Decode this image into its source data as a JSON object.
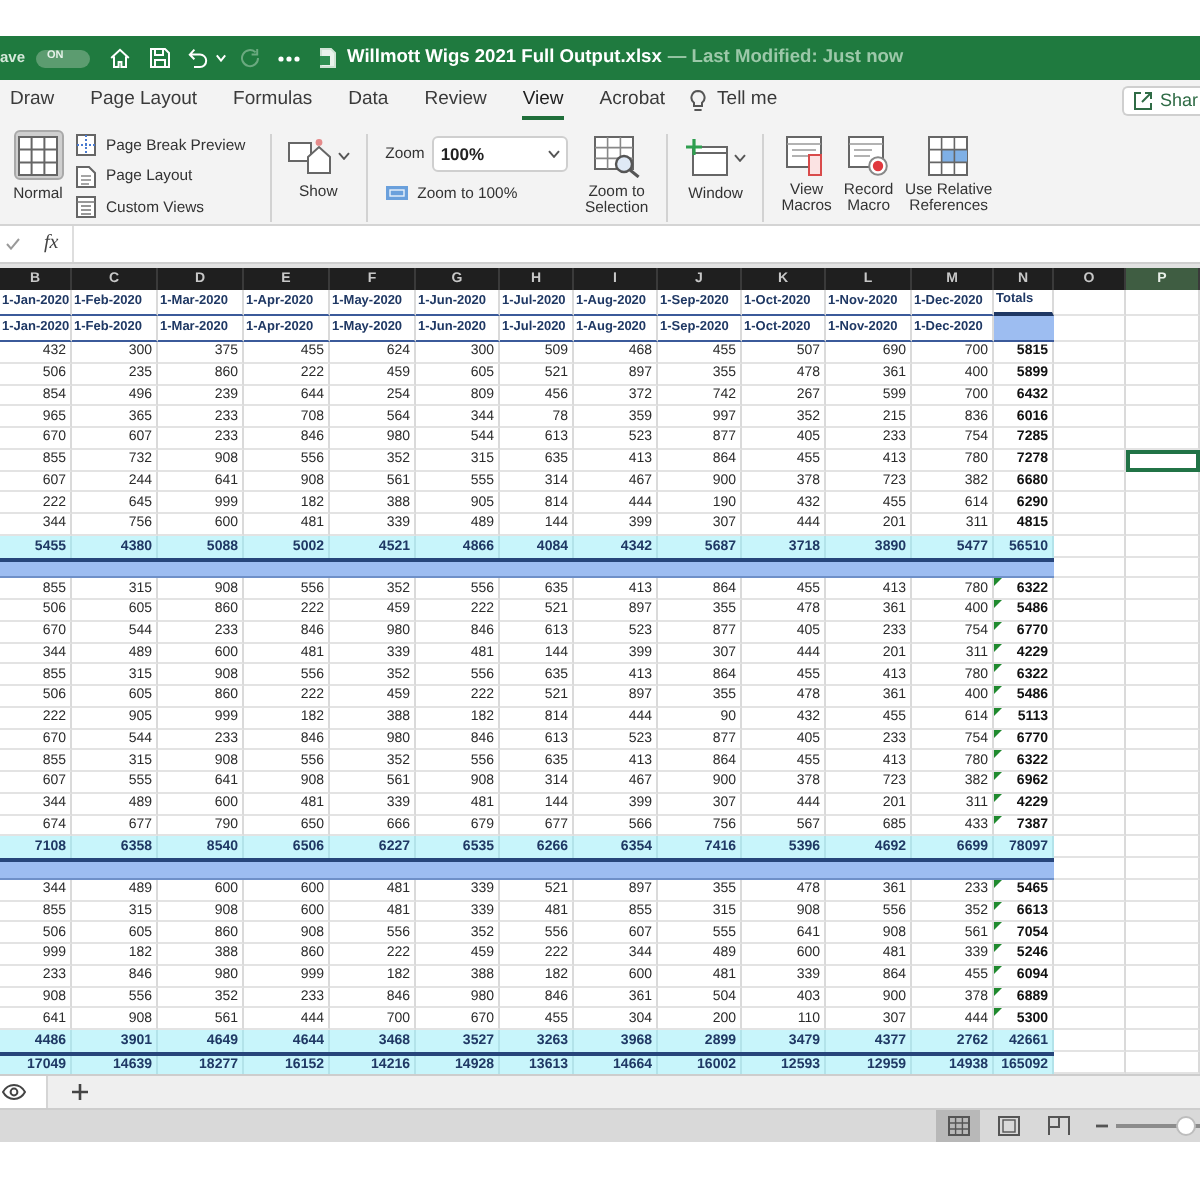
{
  "title_bar": {
    "autosave_label": "ave",
    "autosave_toggle": {
      "label": "ON",
      "on": true
    },
    "quick_access": [
      {
        "kind": "home",
        "disabled": false
      },
      {
        "kind": "save",
        "disabled": false
      },
      {
        "kind": "undo",
        "disabled": false
      },
      {
        "kind": "dropdown",
        "disabled": false
      },
      {
        "kind": "redo",
        "disabled": true
      },
      {
        "kind": "more",
        "disabled": false
      }
    ],
    "file_name": "Willmott Wigs 2021 Full Output.xlsx",
    "status": "— Last Modified: Just now"
  },
  "ribbon_tabs": [
    {
      "label": "Draw",
      "selected": false
    },
    {
      "label": "Page Layout",
      "selected": false
    },
    {
      "label": "Formulas",
      "selected": false
    },
    {
      "label": "Data",
      "selected": false
    },
    {
      "label": "Review",
      "selected": false
    },
    {
      "label": "View",
      "selected": true
    },
    {
      "label": "Acrobat",
      "selected": false
    }
  ],
  "tell_me": "Tell me",
  "share_button": "Shar",
  "ribbon": {
    "normal_view": {
      "label": "Normal",
      "selected": true
    },
    "view_options": [
      {
        "kind": "page_break",
        "label": "Page Break Preview",
        "selected": false
      },
      {
        "kind": "page_layout",
        "label": "Page Layout",
        "selected": false
      },
      {
        "kind": "custom",
        "label": "Custom Views"
      }
    ],
    "show": {
      "label": "Show"
    },
    "zoom": {
      "label": "Zoom",
      "value": "100%",
      "zoom_100_label": "Zoom to 100%",
      "zoom_selection_label": "Zoom to Selection"
    },
    "window": {
      "label": "Window"
    },
    "macros": [
      {
        "kind": "view",
        "label": "View Macros"
      },
      {
        "kind": "record",
        "label": "Record Macro"
      },
      {
        "kind": "relative",
        "label": "Use Relative References"
      }
    ]
  },
  "formula_bar": {
    "function_label": "fx"
  },
  "sheet": {
    "columns": [
      {
        "label": "B",
        "selected": false
      },
      {
        "label": "C",
        "selected": false
      },
      {
        "label": "D",
        "selected": false
      },
      {
        "label": "E",
        "selected": false
      },
      {
        "label": "F",
        "selected": false
      },
      {
        "label": "G",
        "selected": false
      },
      {
        "label": "H",
        "selected": false
      },
      {
        "label": "I",
        "selected": false
      },
      {
        "label": "J",
        "selected": false
      },
      {
        "label": "K",
        "selected": false
      },
      {
        "label": "L",
        "selected": false
      },
      {
        "label": "M",
        "selected": false
      },
      {
        "label": "N",
        "selected": false
      },
      {
        "label": "O",
        "selected": false
      },
      {
        "label": "P",
        "selected": true
      }
    ],
    "rows": [
      {
        "kind": "dates",
        "selected": false,
        "flagged": false,
        "cells": [
          "1-Jan-2020",
          "1-Feb-2020",
          "1-Mar-2020",
          "1-Apr-2020",
          "1-May-2020",
          "1-Jun-2020",
          "1-Jul-2020",
          "1-Aug-2020",
          "1-Sep-2020",
          "1-Oct-2020",
          "1-Nov-2020",
          "1-Dec-2020",
          "Totals"
        ]
      },
      {
        "kind": "dates",
        "selected": false,
        "flagged": false,
        "cells": [
          "1-Jan-2020",
          "1-Feb-2020",
          "1-Mar-2020",
          "1-Apr-2020",
          "1-May-2020",
          "1-Jun-2020",
          "1-Jul-2020",
          "1-Aug-2020",
          "1-Sep-2020",
          "1-Oct-2020",
          "1-Nov-2020",
          "1-Dec-2020"
        ]
      },
      {
        "kind": "data",
        "selected": false,
        "flagged": false,
        "cells": [
          "432",
          "300",
          "375",
          "455",
          "624",
          "300",
          "509",
          "468",
          "455",
          "507",
          "690",
          "700",
          "5815"
        ]
      },
      {
        "kind": "data",
        "selected": false,
        "flagged": false,
        "cells": [
          "506",
          "235",
          "860",
          "222",
          "459",
          "605",
          "521",
          "897",
          "355",
          "478",
          "361",
          "400",
          "5899"
        ]
      },
      {
        "kind": "data",
        "selected": false,
        "flagged": false,
        "cells": [
          "854",
          "496",
          "239",
          "644",
          "254",
          "809",
          "456",
          "372",
          "742",
          "267",
          "599",
          "700",
          "6432"
        ]
      },
      {
        "kind": "data",
        "selected": false,
        "flagged": false,
        "cells": [
          "965",
          "365",
          "233",
          "708",
          "564",
          "344",
          "78",
          "359",
          "997",
          "352",
          "215",
          "836",
          "6016"
        ]
      },
      {
        "kind": "data",
        "selected": false,
        "flagged": false,
        "cells": [
          "670",
          "607",
          "233",
          "846",
          "980",
          "544",
          "613",
          "523",
          "877",
          "405",
          "233",
          "754",
          "7285"
        ]
      },
      {
        "kind": "data",
        "selected": true,
        "flagged": false,
        "cells": [
          "855",
          "732",
          "908",
          "556",
          "352",
          "315",
          "635",
          "413",
          "864",
          "455",
          "413",
          "780",
          "7278"
        ]
      },
      {
        "kind": "data",
        "selected": false,
        "flagged": false,
        "cells": [
          "607",
          "244",
          "641",
          "908",
          "561",
          "555",
          "314",
          "467",
          "900",
          "378",
          "723",
          "382",
          "6680"
        ]
      },
      {
        "kind": "data",
        "selected": false,
        "flagged": false,
        "cells": [
          "222",
          "645",
          "999",
          "182",
          "388",
          "905",
          "814",
          "444",
          "190",
          "432",
          "455",
          "614",
          "6290"
        ]
      },
      {
        "kind": "data",
        "selected": false,
        "flagged": false,
        "cells": [
          "344",
          "756",
          "600",
          "481",
          "339",
          "489",
          "144",
          "399",
          "307",
          "444",
          "201",
          "311",
          "4815"
        ]
      },
      {
        "kind": "total",
        "selected": false,
        "flagged": false,
        "cells": [
          "5455",
          "4380",
          "5088",
          "5002",
          "4521",
          "4866",
          "4084",
          "4342",
          "5687",
          "3718",
          "3890",
          "5477",
          "56510"
        ]
      },
      {
        "kind": "band",
        "selected": false,
        "flagged": false
      },
      {
        "kind": "data",
        "selected": false,
        "flagged": true,
        "cells": [
          "855",
          "315",
          "908",
          "556",
          "352",
          "556",
          "635",
          "413",
          "864",
          "455",
          "413",
          "780",
          "6322"
        ]
      },
      {
        "kind": "data",
        "selected": false,
        "flagged": true,
        "cells": [
          "506",
          "605",
          "860",
          "222",
          "459",
          "222",
          "521",
          "897",
          "355",
          "478",
          "361",
          "400",
          "5486"
        ]
      },
      {
        "kind": "data",
        "selected": false,
        "flagged": true,
        "cells": [
          "670",
          "544",
          "233",
          "846",
          "980",
          "846",
          "613",
          "523",
          "877",
          "405",
          "233",
          "754",
          "6770"
        ]
      },
      {
        "kind": "data",
        "selected": false,
        "flagged": true,
        "cells": [
          "344",
          "489",
          "600",
          "481",
          "339",
          "481",
          "144",
          "399",
          "307",
          "444",
          "201",
          "311",
          "4229"
        ]
      },
      {
        "kind": "data",
        "selected": false,
        "flagged": true,
        "cells": [
          "855",
          "315",
          "908",
          "556",
          "352",
          "556",
          "635",
          "413",
          "864",
          "455",
          "413",
          "780",
          "6322"
        ]
      },
      {
        "kind": "data",
        "selected": false,
        "flagged": true,
        "cells": [
          "506",
          "605",
          "860",
          "222",
          "459",
          "222",
          "521",
          "897",
          "355",
          "478",
          "361",
          "400",
          "5486"
        ]
      },
      {
        "kind": "data",
        "selected": false,
        "flagged": true,
        "cells": [
          "222",
          "905",
          "999",
          "182",
          "388",
          "182",
          "814",
          "444",
          "90",
          "432",
          "455",
          "614",
          "5113"
        ]
      },
      {
        "kind": "data",
        "selected": false,
        "flagged": true,
        "cells": [
          "670",
          "544",
          "233",
          "846",
          "980",
          "846",
          "613",
          "523",
          "877",
          "405",
          "233",
          "754",
          "6770"
        ]
      },
      {
        "kind": "data",
        "selected": false,
        "flagged": true,
        "cells": [
          "855",
          "315",
          "908",
          "556",
          "352",
          "556",
          "635",
          "413",
          "864",
          "455",
          "413",
          "780",
          "6322"
        ]
      },
      {
        "kind": "data",
        "selected": false,
        "flagged": true,
        "cells": [
          "607",
          "555",
          "641",
          "908",
          "561",
          "908",
          "314",
          "467",
          "900",
          "378",
          "723",
          "382",
          "6962"
        ]
      },
      {
        "kind": "data",
        "selected": false,
        "flagged": true,
        "cells": [
          "344",
          "489",
          "600",
          "481",
          "339",
          "481",
          "144",
          "399",
          "307",
          "444",
          "201",
          "311",
          "4229"
        ]
      },
      {
        "kind": "data",
        "selected": false,
        "flagged": true,
        "cells": [
          "674",
          "677",
          "790",
          "650",
          "666",
          "679",
          "677",
          "566",
          "756",
          "567",
          "685",
          "433",
          "7387"
        ]
      },
      {
        "kind": "total",
        "selected": false,
        "flagged": false,
        "cells": [
          "7108",
          "6358",
          "8540",
          "6506",
          "6227",
          "6535",
          "6266",
          "6354",
          "7416",
          "5396",
          "4692",
          "6699",
          "78097"
        ]
      },
      {
        "kind": "band",
        "selected": false,
        "flagged": false
      },
      {
        "kind": "data",
        "selected": false,
        "flagged": true,
        "cells": [
          "344",
          "489",
          "600",
          "600",
          "481",
          "339",
          "521",
          "897",
          "355",
          "478",
          "361",
          "233",
          "5465"
        ]
      },
      {
        "kind": "data",
        "selected": false,
        "flagged": true,
        "cells": [
          "855",
          "315",
          "908",
          "600",
          "481",
          "339",
          "481",
          "855",
          "315",
          "908",
          "556",
          "352",
          "6613"
        ]
      },
      {
        "kind": "data",
        "selected": false,
        "flagged": true,
        "cells": [
          "506",
          "605",
          "860",
          "908",
          "556",
          "352",
          "556",
          "607",
          "555",
          "641",
          "908",
          "561",
          "7054"
        ]
      },
      {
        "kind": "data",
        "selected": false,
        "flagged": true,
        "cells": [
          "999",
          "182",
          "388",
          "860",
          "222",
          "459",
          "222",
          "344",
          "489",
          "600",
          "481",
          "339",
          "5246"
        ]
      },
      {
        "kind": "data",
        "selected": false,
        "flagged": true,
        "cells": [
          "233",
          "846",
          "980",
          "999",
          "182",
          "388",
          "182",
          "600",
          "481",
          "339",
          "864",
          "455",
          "6094"
        ]
      },
      {
        "kind": "data",
        "selected": false,
        "flagged": true,
        "cells": [
          "908",
          "556",
          "352",
          "233",
          "846",
          "980",
          "846",
          "361",
          "504",
          "403",
          "900",
          "378",
          "6889"
        ]
      },
      {
        "kind": "data",
        "selected": false,
        "flagged": true,
        "cells": [
          "641",
          "908",
          "561",
          "444",
          "700",
          "670",
          "455",
          "304",
          "200",
          "110",
          "307",
          "444",
          "5300"
        ]
      },
      {
        "kind": "total",
        "selected": false,
        "flagged": false,
        "cells": [
          "4486",
          "3901",
          "4649",
          "4644",
          "3468",
          "3527",
          "3263",
          "3968",
          "2899",
          "3479",
          "4377",
          "2762",
          "42661"
        ]
      },
      {
        "kind": "grand_total",
        "selected": false,
        "flagged": false,
        "cells": [
          "17049",
          "14639",
          "18277",
          "16152",
          "14216",
          "14928",
          "13613",
          "14664",
          "16002",
          "12593",
          "12959",
          "14938",
          "165092"
        ]
      }
    ]
  },
  "status_bar": {
    "views": [
      {
        "kind": "normal",
        "selected": true
      },
      {
        "kind": "page_layout",
        "selected": false
      },
      {
        "kind": "page_break",
        "selected": false
      }
    ],
    "zoom_slider": {
      "level": 0.95
    }
  }
}
